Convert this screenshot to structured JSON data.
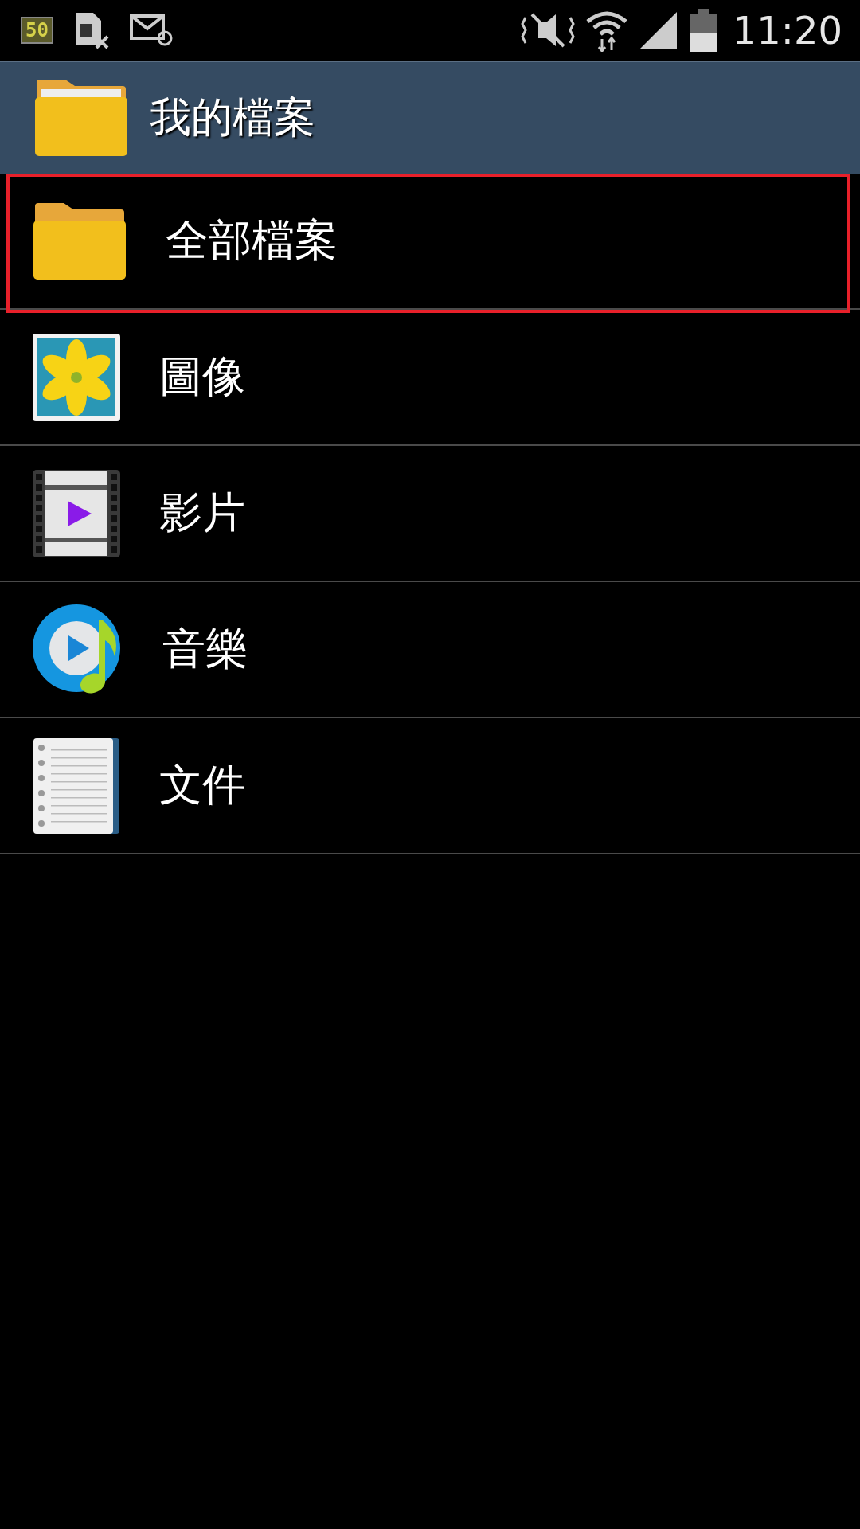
{
  "status_bar": {
    "badge": "50",
    "time": "11:20"
  },
  "header": {
    "title": "我的檔案"
  },
  "items": [
    {
      "kind": "folder",
      "label": "全部檔案",
      "selected": true
    },
    {
      "kind": "images",
      "label": "圖像",
      "selected": false
    },
    {
      "kind": "videos",
      "label": "影片",
      "selected": false
    },
    {
      "kind": "music",
      "label": "音樂",
      "selected": false
    },
    {
      "kind": "documents",
      "label": "文件",
      "selected": false
    }
  ]
}
